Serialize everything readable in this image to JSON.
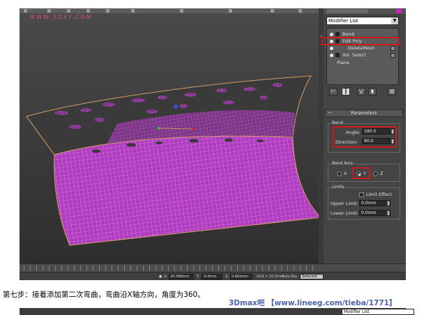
{
  "viewport": {
    "watermark": "WWW.3DXY.COM"
  },
  "command_panel": {
    "modifier_list_label": "Modifier List",
    "stack": [
      {
        "label": "Bend",
        "highlighted": true
      },
      {
        "label": "Edit Poly"
      },
      {
        "label": "DeleteMesh"
      },
      {
        "label": "Vol. Select"
      },
      {
        "label": "Plane"
      }
    ],
    "params": {
      "header": "Parameters",
      "bend_group": "Bend:",
      "angle_label": "Angle:",
      "angle_value": "180.0",
      "direction_label": "Direction:",
      "direction_value": "90.0",
      "axis_group": "Bend Axis:",
      "axis_x": "X",
      "axis_y": "Y",
      "axis_z": "Z",
      "selected_axis": "Y",
      "limits_group": "Limits",
      "limit_effect_label": "Limit Effect",
      "upper_limit_label": "Upper Limit:",
      "upper_limit_value": "0.0mm",
      "lower_limit_label": "Lower Limit:",
      "lower_limit_value": "0.0mm"
    }
  },
  "status_bar": {
    "x_label": "X:",
    "x_value": "20.588mm",
    "y_label": "Y:",
    "y_value": "-0.0mm",
    "z_label": "Z:",
    "z_value": "0.662mm",
    "grid_text": "Grid = 10.0mm",
    "autokey_label": "Auto Key",
    "selected_label": "Selected"
  },
  "caption": "第七步：接着添加第二次弯曲，弯曲沿X轴方向，角度为360。",
  "watermark_bottom": "3Dmax吧 【www.lineeg.com/tieba/1771】",
  "next_screenshot": {
    "modifier_list_label": "Modifier List"
  },
  "colors": {
    "mesh": "#c040c8",
    "highlight": "#d01818",
    "wire": "#e8a0f0"
  }
}
